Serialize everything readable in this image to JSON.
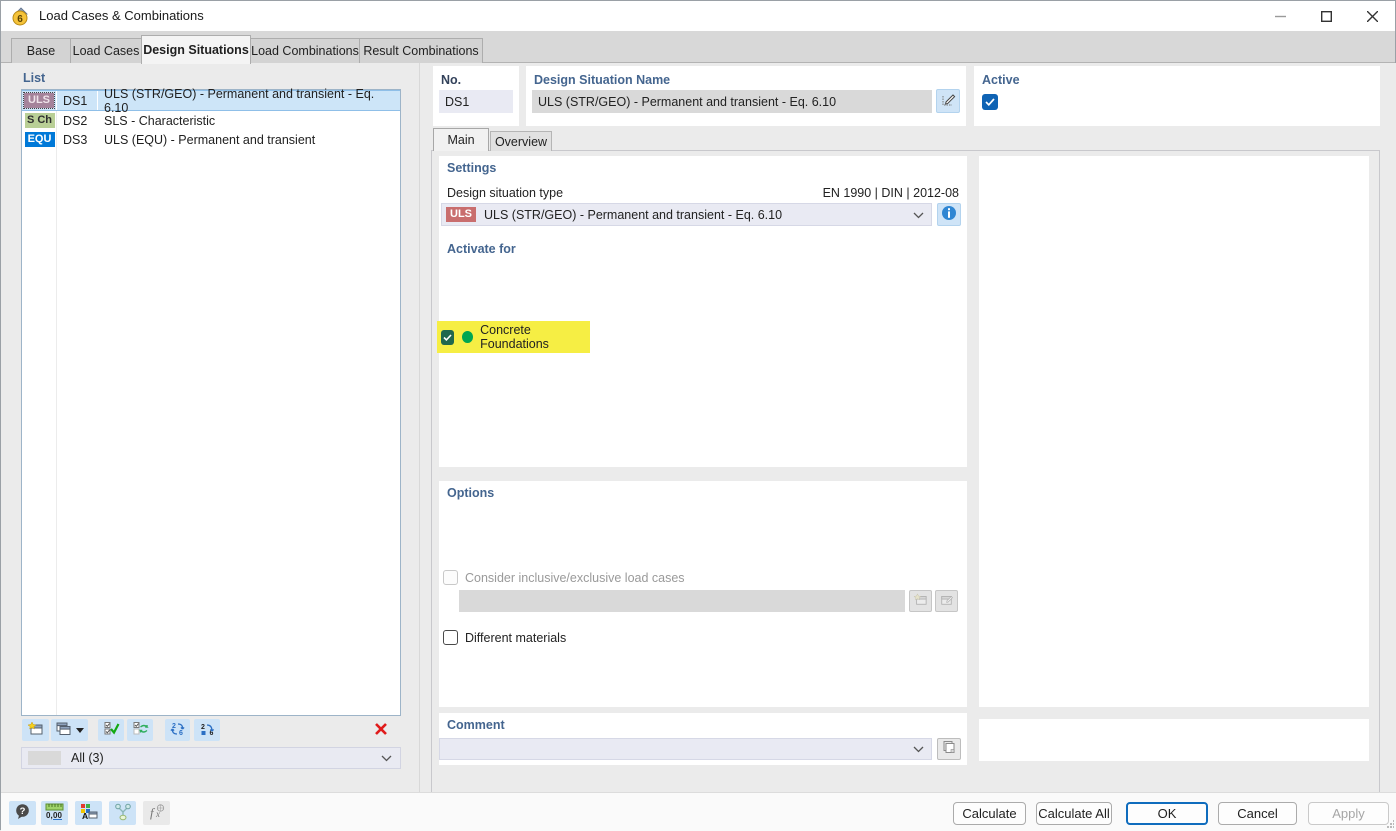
{
  "window": {
    "title": "Load Cases & Combinations"
  },
  "tabs": [
    {
      "label": "Base"
    },
    {
      "label": "Load Cases"
    },
    {
      "label": "Design Situations"
    },
    {
      "label": "Load Combinations"
    },
    {
      "label": "Result Combinations"
    }
  ],
  "list": {
    "header": "List",
    "rows": [
      {
        "badge": "ULS",
        "no": "DS1",
        "name": "ULS (STR/GEO) - Permanent and transient - Eq. 6.10"
      },
      {
        "badge": "S Ch",
        "no": "DS2",
        "name": "SLS - Characteristic"
      },
      {
        "badge": "EQU",
        "no": "DS3",
        "name": "ULS (EQU) - Permanent and transient"
      }
    ],
    "toolbar": [
      "new-design-situation",
      "copy-design-situation",
      "select-all-check",
      "invert-selection",
      "renumber",
      "renumber-sequence",
      "delete"
    ],
    "filter_value": "All (3)"
  },
  "detail": {
    "no_label": "No.",
    "no_value": "DS1",
    "name_label": "Design Situation Name",
    "name_value": "ULS (STR/GEO) - Permanent and transient - Eq. 6.10",
    "active_label": "Active"
  },
  "main_tabs": [
    {
      "label": "Main"
    },
    {
      "label": "Overview"
    }
  ],
  "settings": {
    "heading": "Settings",
    "type_label": "Design situation type",
    "standard": "EN 1990 | DIN | 2012-08",
    "type_badge": "ULS",
    "type_value": "ULS (STR/GEO) - Permanent and transient - Eq. 6.10"
  },
  "activate": {
    "heading": "Activate for",
    "item": "Concrete Foundations"
  },
  "options": {
    "heading": "Options",
    "inclusive_label": "Consider inclusive/exclusive load cases",
    "inclusive_value": "",
    "materials_label": "Different materials"
  },
  "comment": {
    "heading": "Comment",
    "value": ""
  },
  "footer": {
    "buttons": [
      {
        "label": "Calculate"
      },
      {
        "label": "Calculate All"
      },
      {
        "label": "OK"
      },
      {
        "label": "Cancel"
      },
      {
        "label": "Apply"
      }
    ]
  },
  "colors": {
    "accent": "#0f6cbd",
    "selection": "#cde5f8",
    "uls_badge": "#c96e6e",
    "uls_badge_selected": "#a5839b",
    "sch_badge": "#b9cf96",
    "equ_badge": "#0079d8",
    "highlight_yellow": "#f6ee44",
    "active_green": "#00a651"
  }
}
